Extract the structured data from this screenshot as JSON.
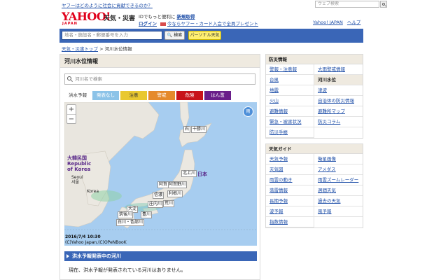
{
  "top": {
    "promo": "ヤフーはどのように社会に貢献できるのか？",
    "web_search_placeholder": "ウェブ検索"
  },
  "header": {
    "logo": "YAHOO!",
    "logo_sub": "JAPAN",
    "service": "天気・災害",
    "login_prompt": "IDでもっと便利に",
    "register": "新規取得",
    "login": "ログイン",
    "campaign": "今ならヤフー・カード入会で全員プレゼント",
    "links": [
      "Yahoo! JAPAN",
      "ヘルプ"
    ]
  },
  "searchbar": {
    "placeholder": "地名・施設名・郵便番号を入力",
    "search_button": "検索",
    "personal_button": "パーソナル天気"
  },
  "breadcrumb": {
    "home": "天気・災害トップ",
    "separator": ">",
    "current": "河川水位情報"
  },
  "main": {
    "title": "河川水位情報",
    "river_search_placeholder": "河川名で検索",
    "legend": {
      "label": "洪水予報",
      "items": [
        {
          "label": "発表なし",
          "color": "#8cc3e8",
          "text_color": "#ffffff"
        },
        {
          "label": "注意",
          "color": "#e9c830",
          "text_color": "#333333"
        },
        {
          "label": "警戒",
          "color": "#e58a2b",
          "text_color": "#ffffff"
        },
        {
          "label": "危険",
          "color": "#c8131a",
          "text_color": "#ffffff"
        },
        {
          "label": "はん濫",
          "color": "#6a1e8a",
          "text_color": "#ffffff"
        }
      ]
    },
    "map": {
      "rain_button": "雨",
      "river_labels": [
        "石",
        "十勝川",
        "北上川",
        "阿賀野川",
        "阿賀",
        "利根川",
        "信濃",
        "荒川",
        "庄内川",
        "大淀",
        "筑後川",
        "豊川",
        "白川・色部川"
      ],
      "place_labels": [
        "大韓民国",
        "Republic",
        "of Korea",
        "Seoul",
        "서울",
        "日本",
        "Korea"
      ],
      "timestamp": "2016/7/4 10:30",
      "copyright": "(C)Yahoo Japan,(C)OPeNBooK"
    },
    "alert_title": "洪水予報発表中の河川",
    "alert_text": "現在、洪水予報が発表されている河川はありません。"
  },
  "sidebar": {
    "disaster": {
      "title": "防災情報",
      "items": [
        "警報・注意報",
        "大雨警戒情報",
        "台風",
        "河川水位",
        "地震",
        "津波",
        "火山",
        "自治体の防災情報",
        "避難情報",
        "避難所マップ",
        "緊急・被害状況",
        "防災コラム",
        "防災手帳"
      ],
      "current_index": 3
    },
    "guide": {
      "title": "天気ガイド",
      "items": [
        "天気予報",
        "衛星画像",
        "天気図",
        "アメダス",
        "雨雲の動き",
        "雨雲ズームレーダー",
        "落雷情報",
        "週間天気",
        "長期予報",
        "過去の天気",
        "波予報",
        "風予報",
        "指数情報"
      ]
    }
  },
  "colors": {
    "accent_blue": "#3a66b7",
    "brand_red": "#e0001b",
    "header_beige": "#efeae0",
    "link": "#1f4fa8"
  }
}
